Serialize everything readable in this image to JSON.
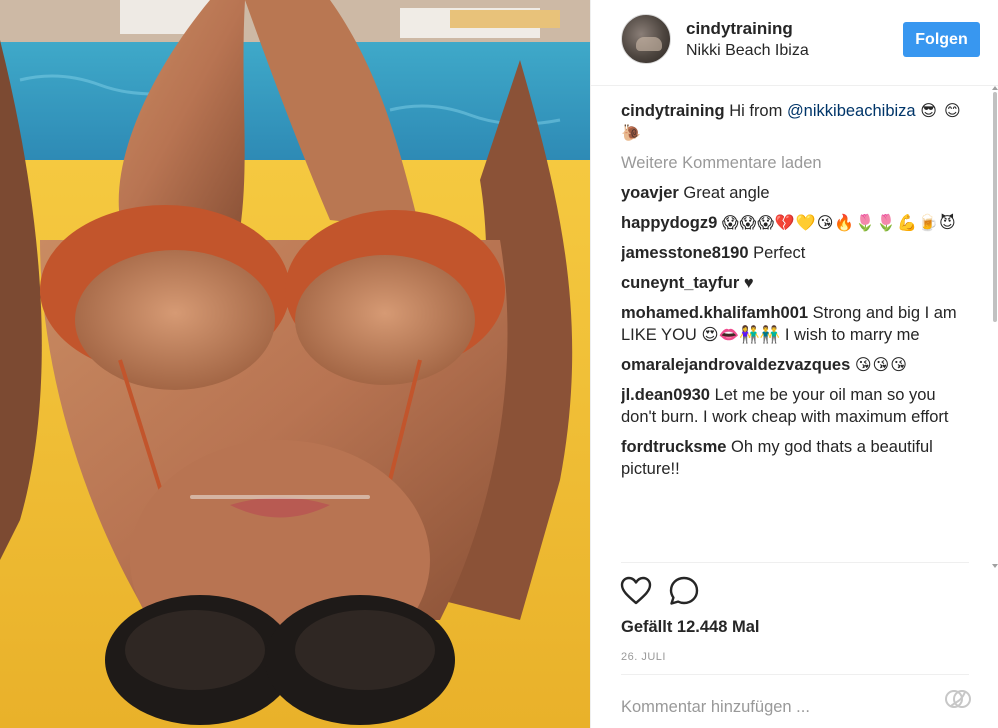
{
  "post": {
    "author": "cindytraining",
    "location": "Nikki Beach Ibiza",
    "follow_label": "Folgen",
    "caption": {
      "user": "cindytraining",
      "text_before": "Hi from ",
      "mention": "@nikkibeachibiza",
      "emojis": "😎 😊🐌"
    },
    "load_more": "Weitere Kommentare laden",
    "comments": [
      {
        "user": "yoavjer",
        "text": "Great angle"
      },
      {
        "user": "happydogz9",
        "text": "😱😱😱💔💛😘🔥🌷🌷💪🍺😈"
      },
      {
        "user": "jamesstone8190",
        "text": "Perfect"
      },
      {
        "user": "cuneynt_tayfur",
        "text": "♥"
      },
      {
        "user": "mohamed.khalifamh001",
        "text": "Strong and big I am LIKE YOU 😍👄👫👬 I wish to marry me"
      },
      {
        "user": "omaralejandrovaldezvazques",
        "text": "😘😘😘"
      },
      {
        "user": "jl.dean0930",
        "text": "Let me be your oil man so you don't burn. I work cheap with maximum effort"
      },
      {
        "user": "fordtrucksme",
        "text": "Oh my god thats a beautiful picture!!"
      }
    ],
    "likes": "Gefällt 12.448 Mal",
    "date": "26. JULI",
    "comment_placeholder": "Kommentar hinzufügen ..."
  },
  "icons": {
    "like": "heart-icon",
    "comment": "speech-bubble-icon",
    "more": "more-options-icon"
  },
  "colors": {
    "follow_button": "#3897f0",
    "mention": "#003569",
    "muted": "#999999",
    "text": "#262626"
  }
}
